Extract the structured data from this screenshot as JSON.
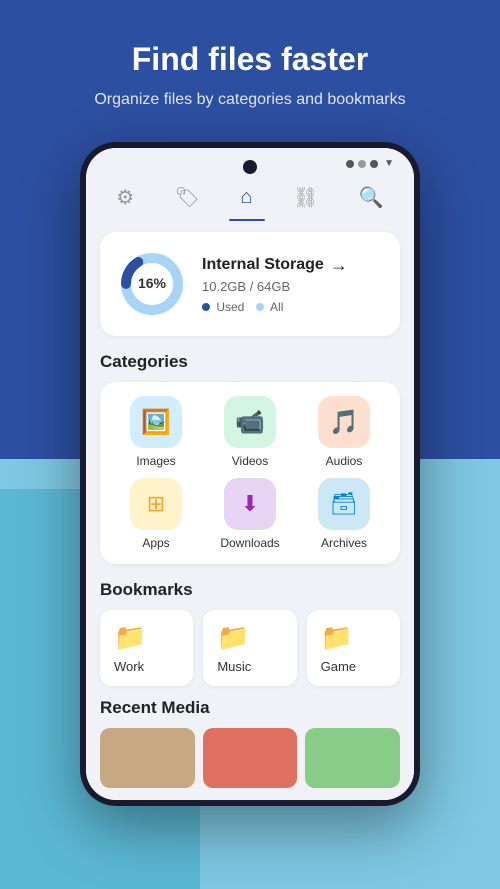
{
  "header": {
    "title": "Find files faster",
    "subtitle": "Organize files by categories and bookmarks"
  },
  "nav": {
    "items": [
      {
        "id": "settings",
        "icon": "⚙",
        "active": false
      },
      {
        "id": "tag",
        "icon": "🏷",
        "active": false
      },
      {
        "id": "home",
        "icon": "🏠",
        "active": true
      },
      {
        "id": "link",
        "icon": "🔗",
        "active": false
      },
      {
        "id": "search",
        "icon": "🔍",
        "active": false
      }
    ]
  },
  "storage": {
    "title": "Internal Storage",
    "arrow": "→",
    "used_size": "10.2GB / 64GB",
    "used_percent": 16,
    "legend_used": "Used",
    "legend_all": "All",
    "color_used": "#2d4fa1",
    "color_all": "#a8d4f5"
  },
  "categories": {
    "section_label": "Categories",
    "items": [
      {
        "id": "images",
        "label": "Images",
        "icon": "🖼",
        "bg": "#d0eeff"
      },
      {
        "id": "videos",
        "label": "Videos",
        "icon": "📹",
        "bg": "#d4f5e2"
      },
      {
        "id": "audios",
        "label": "Audios",
        "icon": "🎵",
        "bg": "#ffe0d0"
      },
      {
        "id": "apps",
        "label": "Apps",
        "icon": "⊞",
        "bg": "#fff3cc"
      },
      {
        "id": "downloads",
        "label": "Downloads",
        "icon": "⬇",
        "bg": "#e8d5f5"
      },
      {
        "id": "archives",
        "label": "Archives",
        "icon": "🗃",
        "bg": "#cce8f5"
      }
    ]
  },
  "bookmarks": {
    "section_label": "Bookmarks",
    "items": [
      {
        "id": "work",
        "label": "Work",
        "color": "#2196F3"
      },
      {
        "id": "music",
        "label": "Music",
        "color": "#2196F3"
      },
      {
        "id": "game",
        "label": "Game",
        "color": "#2196F3"
      }
    ]
  },
  "recent_media": {
    "section_label": "Recent Media",
    "thumbs": [
      {
        "id": "thumb1",
        "color": "#c8a882"
      },
      {
        "id": "thumb2",
        "color": "#e07060"
      },
      {
        "id": "thumb3",
        "color": "#88cc88"
      }
    ]
  }
}
